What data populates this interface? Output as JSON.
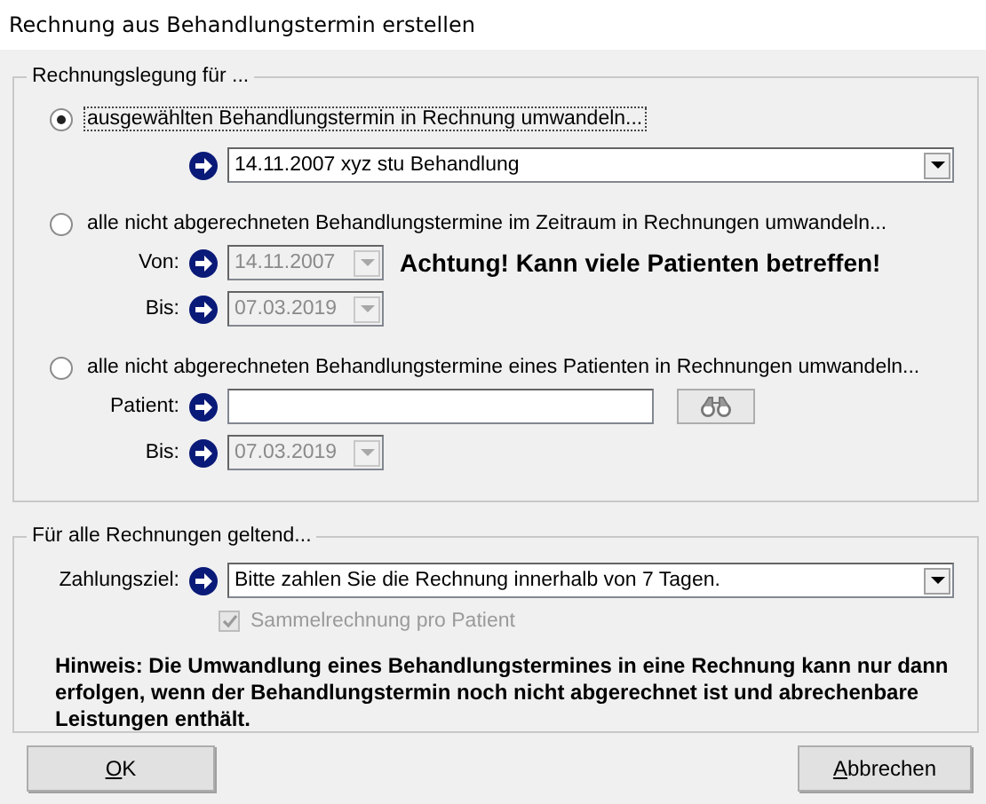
{
  "window": {
    "title": "Rechnung aus Behandlungstermin erstellen"
  },
  "billing": {
    "legend": "Rechnungslegung  für ...",
    "options": [
      {
        "kind": "appointment",
        "label": "ausgewählten Behandlungstermin in Rechnung umwandeln...",
        "selected": true,
        "focused": true,
        "appointment": {
          "value": "14.11.2007 xyz stu Behandlung",
          "disabled": false
        }
      },
      {
        "kind": "period",
        "label": "alle nicht abgerechneten Behandlungstermine im Zeitraum in Rechnungen umwandeln...",
        "selected": false,
        "focused": false,
        "from": {
          "label": "Von:",
          "value": "14.11.2007",
          "disabled": true
        },
        "to": {
          "label": "Bis:",
          "value": "07.03.2019",
          "disabled": true
        },
        "warning": "Achtung! Kann viele Patienten betreffen!"
      },
      {
        "kind": "patient",
        "label": "alle nicht abgerechneten Behandlungstermine eines Patienten in Rechnungen umwandeln...",
        "selected": false,
        "focused": false,
        "patient": {
          "label": "Patient:"
        },
        "to": {
          "label": "Bis:",
          "value": "07.03.2019",
          "disabled": true
        }
      }
    ]
  },
  "general": {
    "legend": "Für alle Rechnungen geltend...",
    "payment_term": {
      "label": "Zahlungsziel:",
      "value": "Bitte zahlen Sie die Rechnung innerhalb von 7 Tagen.",
      "disabled": false
    },
    "collective_invoice": {
      "label": "Sammelrechnung pro Patient",
      "checked": true,
      "disabled": true
    },
    "note": "Hinweis: Die Umwandlung eines Behandlungstermines in eine Rechnung kann nur dann erfolgen, wenn der Behandlungstermin noch nicht abgerechnet ist und abrechenbare Leistungen enthält."
  },
  "buttons": [
    {
      "label": "OK"
    },
    {
      "label": "Abbrechen"
    }
  ]
}
